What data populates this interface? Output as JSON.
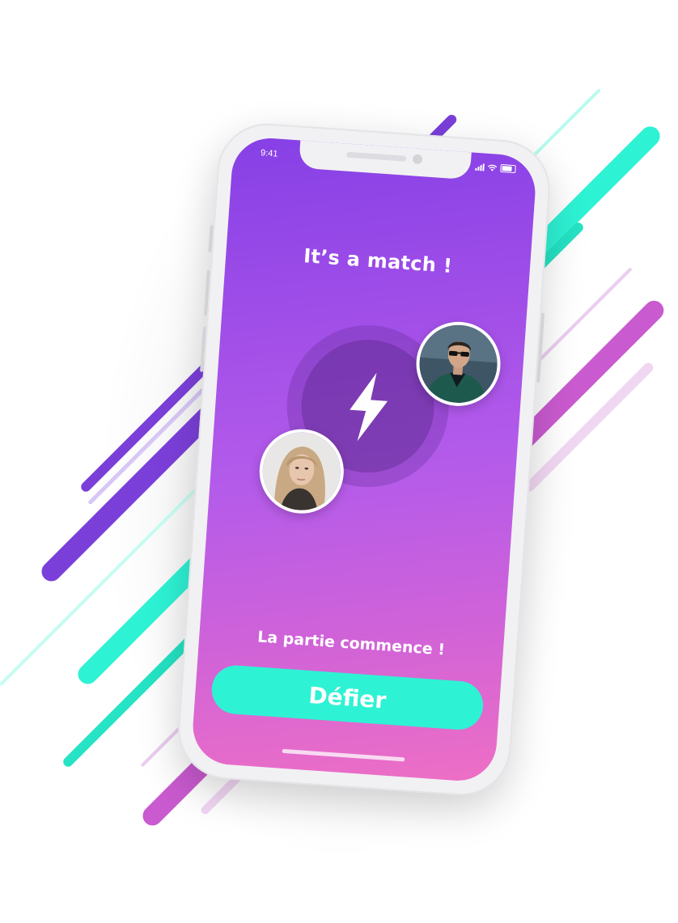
{
  "status_bar": {
    "time": "9:41"
  },
  "match": {
    "title": "It’s a match !",
    "subtitle": "La partie commence !",
    "cta_label": "Défier"
  },
  "icons": {
    "center": "lightning-bolt-icon"
  },
  "colors": {
    "accent_teal": "#2EF2D4",
    "gradient_top": "#8640E6",
    "gradient_bottom": "#EE6FC4",
    "streak_purple": "#7B3FD9",
    "streak_pink": "#C95ACF"
  }
}
